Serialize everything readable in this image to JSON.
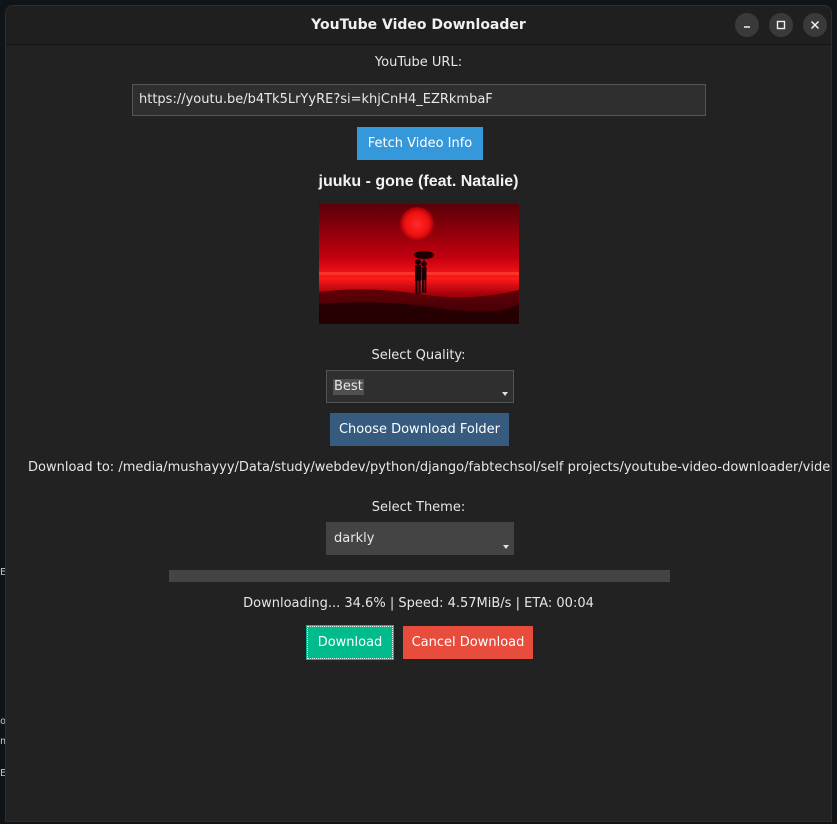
{
  "window": {
    "title": "YouTube Video Downloader"
  },
  "url_section": {
    "label": "YouTube URL:",
    "value": "https://youtu.be/b4Tk5LrYyRE?si=khjCnH4_EZRkmbaF"
  },
  "fetch_button": {
    "label": "Fetch Video Info"
  },
  "video": {
    "title": "juuku - gone (feat. Natalie)"
  },
  "quality": {
    "label": "Select Quality:",
    "selected": "Best"
  },
  "folder_button": {
    "label": "Choose Download Folder"
  },
  "download_path": {
    "text": "Download to: /media/mushayyy/Data/study/webdev/python/django/fabtechsol/self projects/youtube-video-downloader/videos"
  },
  "theme": {
    "label": "Select Theme:",
    "selected": "darkly"
  },
  "progress": {
    "percent": 0,
    "status_text": "Downloading...  34.6% | Speed:   4.57MiB/s | ETA: 00:04"
  },
  "actions": {
    "download_label": "Download",
    "cancel_label": "Cancel Download"
  },
  "colors": {
    "window_bg": "#222222",
    "fetch_button": "#3498db",
    "folder_button": "#375a7f",
    "download_button": "#00bc8c",
    "cancel_button": "#e74c3c",
    "progress_trough": "#444444"
  },
  "icons": {
    "minimize": "minimize-icon",
    "maximize": "maximize-icon",
    "close": "close-icon"
  }
}
